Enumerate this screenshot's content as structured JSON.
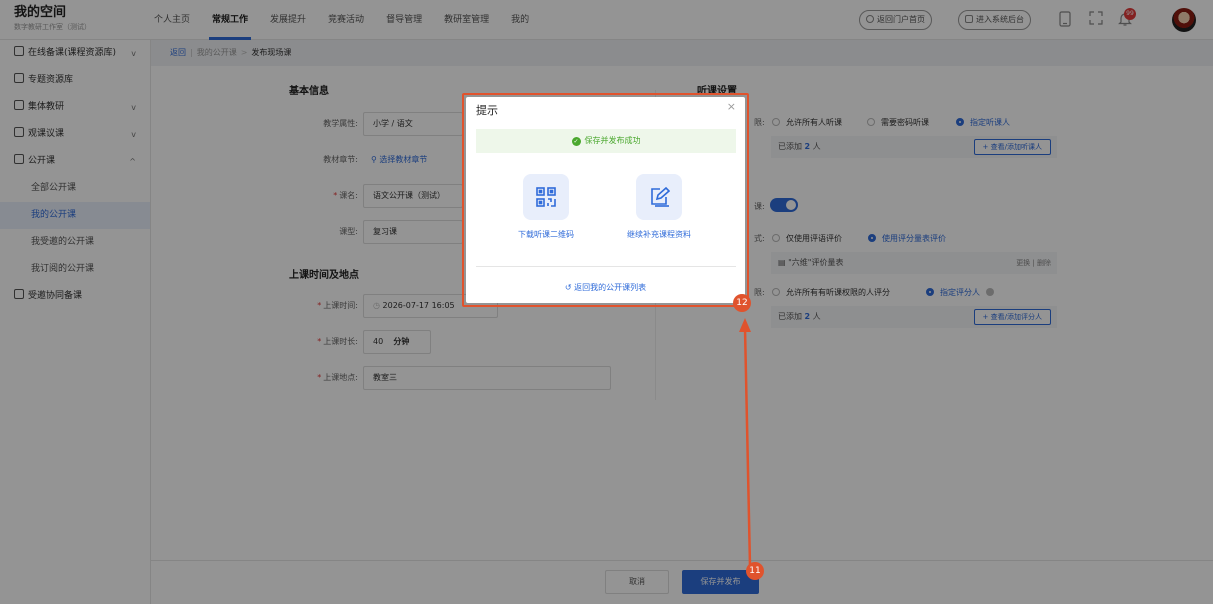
{
  "brand": {
    "title": "我的空间",
    "subtitle": "数字教研工作室（测试）"
  },
  "nav": [
    "个人主页",
    "常规工作",
    "发展提升",
    "竞赛活动",
    "督导管理",
    "教研室管理",
    "我的"
  ],
  "nav_active": "常规工作",
  "topbar": {
    "portal_btn": "返回门户首页",
    "admin_btn": "进入系统后台",
    "notification_count": "99"
  },
  "sidebar": {
    "items": [
      {
        "label": "在线备课(课程资源库)",
        "chevron": "v"
      },
      {
        "label": "专题资源库",
        "chevron": ""
      },
      {
        "label": "集体教研",
        "chevron": "v"
      },
      {
        "label": "观课议课",
        "chevron": "v"
      },
      {
        "label": "公开课",
        "chevron": "^"
      }
    ],
    "subitems": [
      "全部公开课",
      "我的公开课",
      "我受邀的公开课",
      "我订阅的公开课"
    ],
    "active_sub": "我的公开课",
    "last": "受邀协同备课"
  },
  "breadcrumb": {
    "back": "返回",
    "parent": "我的公开课",
    "current": "发布现场课"
  },
  "basic": {
    "title": "基本信息",
    "attr_label": "教学属性:",
    "attr_value": "小学 / 语文",
    "chapter_label": "教材章节:",
    "chapter_link": "选择教材章节",
    "name_label": "课名:",
    "name_value": "语文公开课（测试）",
    "type_label": "课型:",
    "type_value": "复习课"
  },
  "schedule": {
    "title": "上课时间及地点",
    "time_label": "上课时间:",
    "time_value": "2026-07-17 16:05",
    "duration_label": "上课时长:",
    "duration_value": "40",
    "duration_unit": "分钟",
    "place_label": "上课地点:",
    "place_value": "教室三"
  },
  "listen": {
    "title": "听课设置",
    "perm_label": "限:",
    "options": [
      "允许所有人听课",
      "需要密码听课",
      "指定听课人"
    ],
    "selected": "指定听课人",
    "added_prefix": "已添加",
    "added_count": "2",
    "added_suffix": "人",
    "view_btn": "+ 查看/添加听课人"
  },
  "evaluate": {
    "switch_label": "课:",
    "mode_label": "式:",
    "mode_options": [
      "仅使用评语评价",
      "使用评分量表评价"
    ],
    "mode_selected": "使用评分量表评价",
    "scale_name": "\"六维\"评价量表",
    "scale_links": "更换 | 删除",
    "perm_label": "限:",
    "perm_options": [
      "允许所有有听课权限的人评分",
      "指定评分人"
    ],
    "perm_selected": "指定评分人",
    "added_prefix": "已添加",
    "added_count": "2",
    "added_suffix": "人",
    "view_btn": "+ 查看/添加评分人"
  },
  "footer": {
    "cancel": "取消",
    "save": "保存并发布"
  },
  "modal": {
    "title": "提示",
    "close": "×",
    "success": "保存并发布成功",
    "action1": "下载听课二维码",
    "action2": "继续补充课程资料",
    "back_link": "返回我的公开课列表"
  },
  "steps": {
    "save_step": "11",
    "modal_step": "12"
  },
  "colors": {
    "accent": "#2f6bd9",
    "annotation": "#e0532d",
    "success": "#4aa82e"
  }
}
